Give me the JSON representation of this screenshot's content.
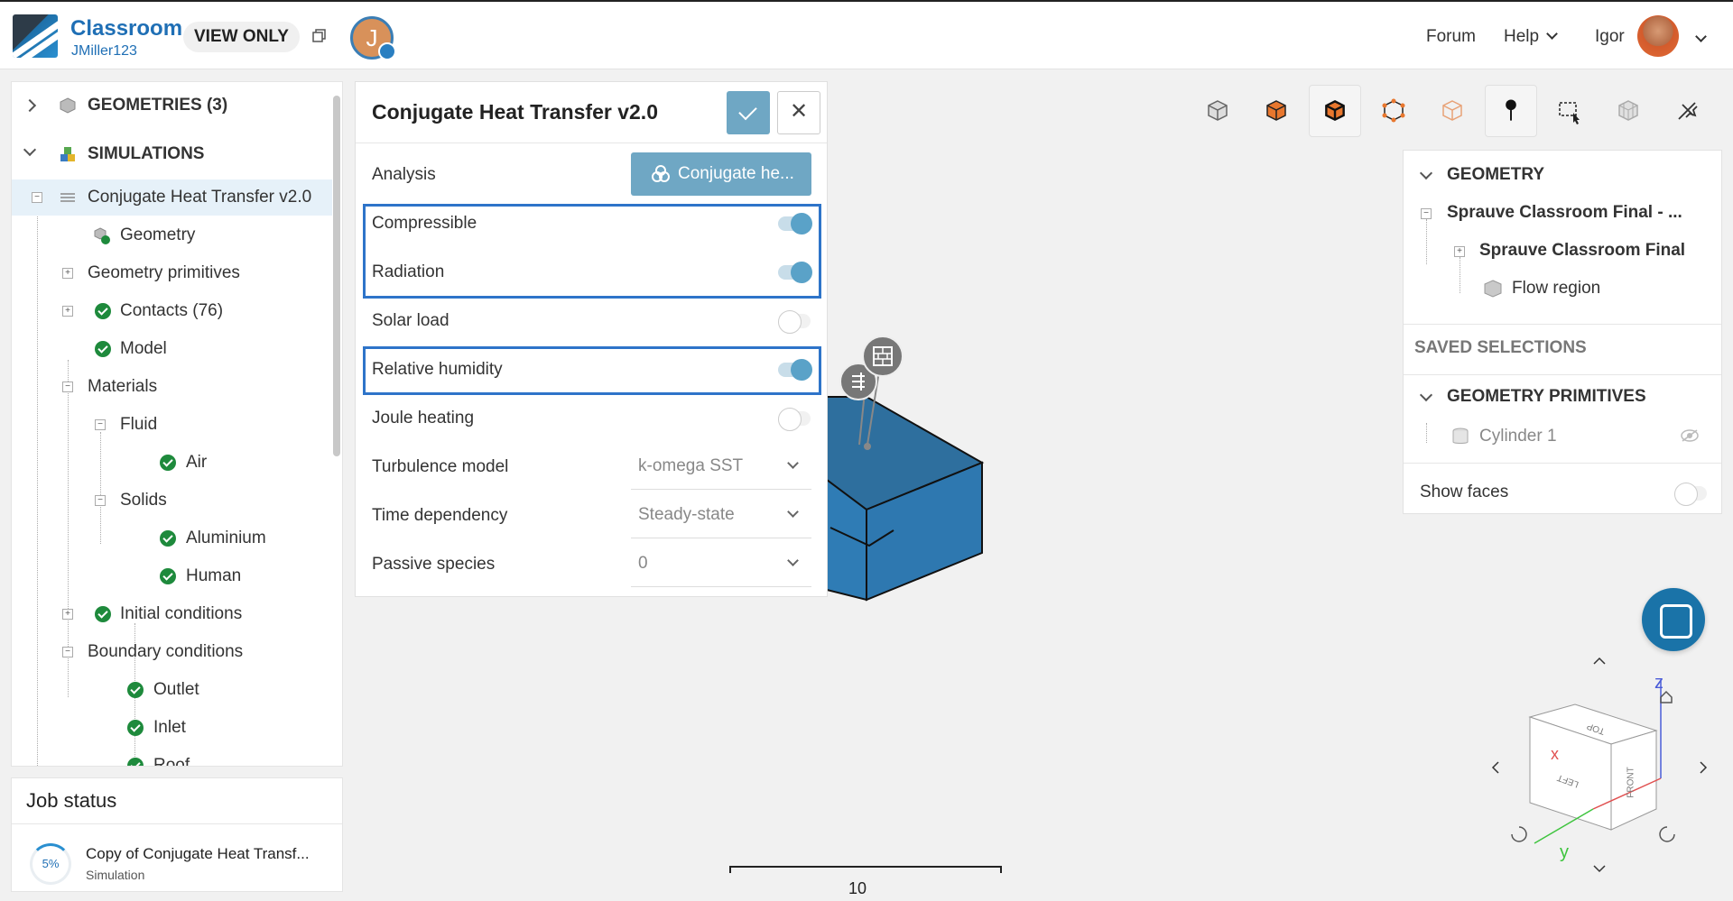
{
  "header": {
    "brand_title": "Classroom",
    "brand_user": "JMiller123",
    "view_only_label": "VIEW ONLY",
    "user_initial": "J",
    "forum_label": "Forum",
    "help_label": "Help",
    "username": "Igor"
  },
  "tree": {
    "geometries_label": "GEOMETRIES (3)",
    "simulations_label": "SIMULATIONS",
    "sim_name": "Conjugate Heat Transfer v2.0",
    "geometry_label": "Geometry",
    "geometry_primitives_label": "Geometry primitives",
    "contacts_label": "Contacts (76)",
    "model_label": "Model",
    "materials_label": "Materials",
    "fluid_label": "Fluid",
    "air_label": "Air",
    "solids_label": "Solids",
    "aluminium_label": "Aluminium",
    "human_label": "Human",
    "initial_conditions_label": "Initial conditions",
    "boundary_conditions_label": "Boundary conditions",
    "outlet_label": "Outlet",
    "inlet_label": "Inlet",
    "roof_label": "Roof"
  },
  "job_status": {
    "title": "Job status",
    "progress": "5%",
    "job_name": "Copy of Conjugate Heat Transf...",
    "job_type": "Simulation"
  },
  "dialog": {
    "title": "Conjugate Heat Transfer v2.0",
    "analysis_label": "Analysis",
    "analysis_value": "Conjugate he...",
    "compressible_label": "Compressible",
    "compressible_on": true,
    "radiation_label": "Radiation",
    "radiation_on": true,
    "solar_load_label": "Solar load",
    "solar_load_on": false,
    "relative_humidity_label": "Relative humidity",
    "relative_humidity_on": true,
    "joule_heating_label": "Joule heating",
    "joule_heating_on": false,
    "turbulence_label": "Turbulence model",
    "turbulence_value": "k-omega SST",
    "time_dependency_label": "Time dependency",
    "time_dependency_value": "Steady-state",
    "passive_species_label": "Passive species",
    "passive_species_value": "0"
  },
  "scene": {
    "geometry_header": "GEOMETRY",
    "assembly_name": "Sprauve Classroom Final - ...",
    "part_name": "Sprauve Classroom Final",
    "flow_region_label": "Flow region",
    "saved_selections_header": "SAVED SELECTIONS",
    "geometry_primitives_header": "GEOMETRY PRIMITIVES",
    "cylinder_label": "Cylinder 1",
    "show_faces_label": "Show faces",
    "show_faces_on": false
  },
  "viewport": {
    "scale_label": "10 m",
    "axis_z": "z",
    "axis_x": "x",
    "axis_y": "y",
    "cube_top": "TOP",
    "cube_left": "LEFT",
    "cube_front": "FRONT"
  },
  "colors": {
    "accent": "#1f6fb5",
    "box_blue": "#2e78b0",
    "highlight": "#2e74c9",
    "check_green": "#1e8a3c"
  }
}
